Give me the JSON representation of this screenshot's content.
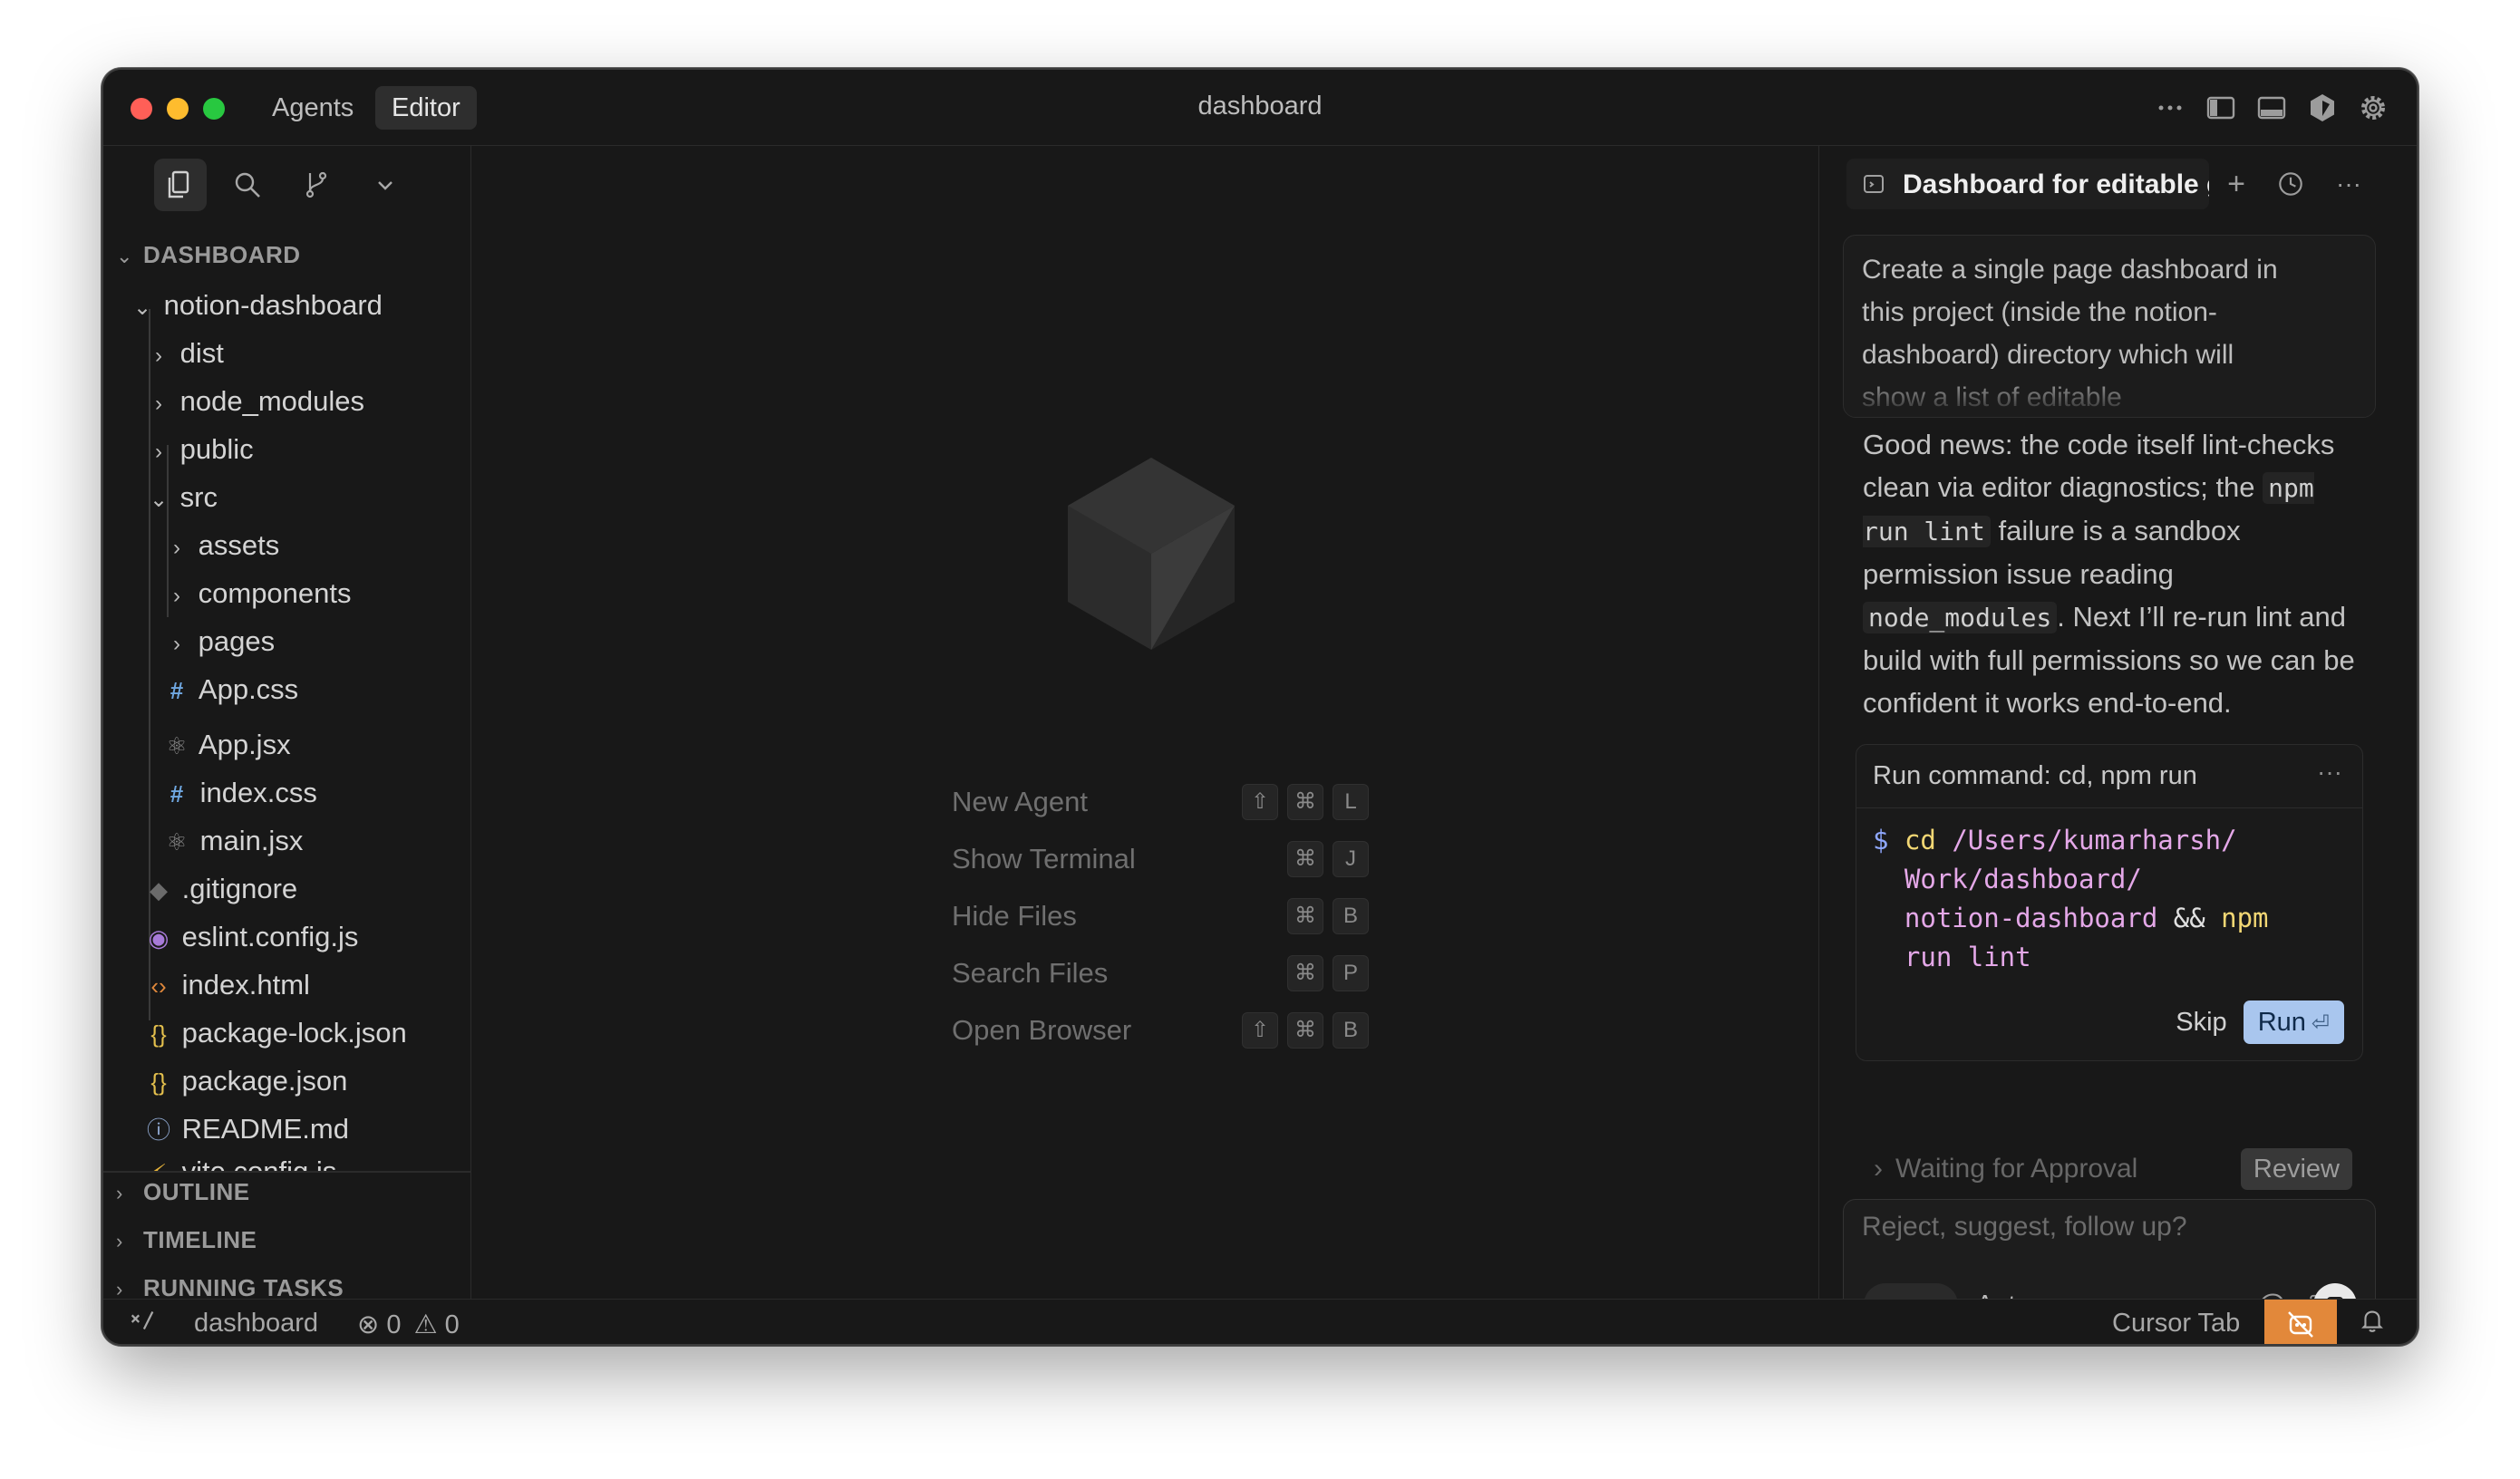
{
  "titlebar": {
    "tabs": [
      "Agents",
      "Editor"
    ],
    "active_tab": "Editor",
    "title": "dashboard",
    "icons": [
      "more-icon",
      "toggle-sidebar-icon",
      "toggle-panel-icon",
      "cursor-logo-icon",
      "settings-icon"
    ]
  },
  "sidebar": {
    "toolbar_icons": [
      "explorer-icon",
      "search-icon",
      "source-control-icon",
      "chevron-down-icon"
    ],
    "root_label": "DASHBOARD",
    "tree": [
      {
        "label": "notion-dashboard",
        "type": "folder",
        "open": true
      },
      {
        "label": "dist",
        "type": "folder",
        "open": false
      },
      {
        "label": "node_modules",
        "type": "folder",
        "open": false
      },
      {
        "label": "public",
        "type": "folder",
        "open": false
      },
      {
        "label": "src",
        "type": "folder",
        "open": true
      },
      {
        "label": "assets",
        "type": "folder",
        "open": false
      },
      {
        "label": "components",
        "type": "folder",
        "open": false
      },
      {
        "label": "pages",
        "type": "folder",
        "open": false
      },
      {
        "label": "App.css",
        "type": "css"
      },
      {
        "label": "App.jsx",
        "type": "react"
      },
      {
        "label": "index.css",
        "type": "css"
      },
      {
        "label": "main.jsx",
        "type": "react"
      },
      {
        "label": ".gitignore",
        "type": "git"
      },
      {
        "label": "eslint.config.js",
        "type": "eslint"
      },
      {
        "label": "index.html",
        "type": "html"
      },
      {
        "label": "package-lock.json",
        "type": "json"
      },
      {
        "label": "package.json",
        "type": "json"
      },
      {
        "label": "README.md",
        "type": "info"
      },
      {
        "label": "vite.config.js",
        "type": "vite"
      }
    ],
    "sections": [
      "OUTLINE",
      "TIMELINE",
      "RUNNING TASKS"
    ]
  },
  "main": {
    "shortcuts": [
      {
        "label": "New Agent",
        "keys": [
          "⇧",
          "⌘",
          "L"
        ]
      },
      {
        "label": "Show Terminal",
        "keys": [
          "⌘",
          "J"
        ]
      },
      {
        "label": "Hide Files",
        "keys": [
          "⌘",
          "B"
        ]
      },
      {
        "label": "Search Files",
        "keys": [
          "⌘",
          "P"
        ]
      },
      {
        "label": "Open Browser",
        "keys": [
          "⇧",
          "⌘",
          "B"
        ]
      }
    ]
  },
  "agent": {
    "chat_title": "Dashboard for editable g",
    "prompt": "Create a single page dashboard in this project (inside the notion-dashboard) directory which will show a list of editable",
    "message_parts": {
      "p1": "Good news: the code itself lint-checks clean via editor diagnostics; the ",
      "code1": "npm run lint",
      "p2": " failure is a sandbox permission issue reading ",
      "code2": "node_modules",
      "p3": ". Next I’ll re-run lint and build with full permissions so we can be confident it works end-to-end."
    },
    "command_card": {
      "title": "Run command: cd, npm run",
      "prompt_symbol": "$",
      "lines": [
        [
          "cd",
          " /Users/kumarharsh/"
        ],
        [
          "",
          "Work/dashboard/"
        ],
        [
          "",
          "notion-dashboard",
          " && ",
          "npm"
        ],
        [
          "",
          "run lint"
        ]
      ],
      "skip_label": "Skip",
      "run_label": "Run",
      "run_hint": "⏎"
    },
    "waiting_label": "Waiting for Approval",
    "review_label": "Review",
    "composer": {
      "placeholder": "Reject, suggest, follow up?",
      "mode_glyph": "∞",
      "model": "Auto",
      "icons": [
        "mention-icon",
        "image-icon",
        "stop-icon"
      ]
    }
  },
  "statusbar": {
    "branch": "dashboard",
    "errors": "0",
    "warnings": "0",
    "cursor_tab": "Cursor Tab"
  },
  "colors": {
    "background": "#181818",
    "accent_run": "#a9c6ee",
    "status_accent": "#e2883a"
  }
}
